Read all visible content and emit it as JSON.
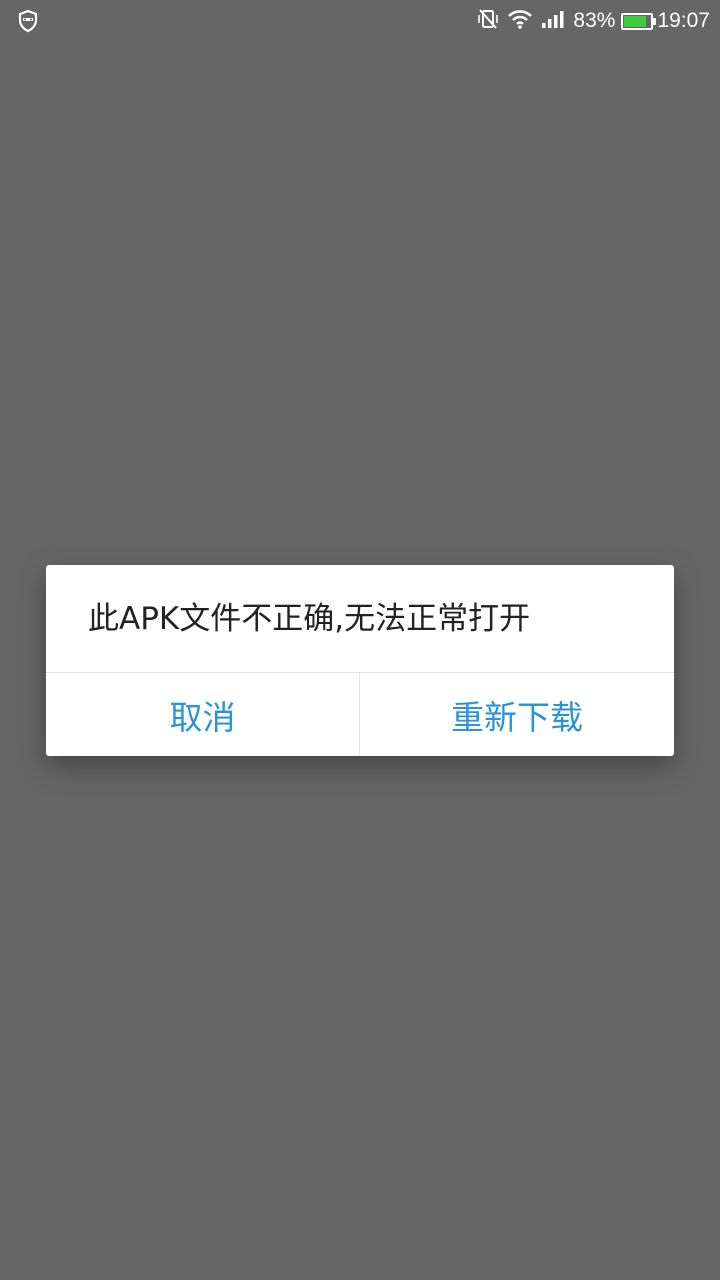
{
  "status_bar": {
    "left_icon": "shield-face-icon",
    "icons": [
      "vibrate-off-icon",
      "wifi-icon",
      "signal-icon"
    ],
    "battery_percent_text": "83%",
    "battery_level": 0.83,
    "battery_color": "#3ccd3c",
    "time": "19:07"
  },
  "dialog": {
    "message": "此APK文件不正确,无法正常打开",
    "cancel_label": "取消",
    "redownload_label": "重新下载",
    "accent_color": "#2b93da"
  }
}
